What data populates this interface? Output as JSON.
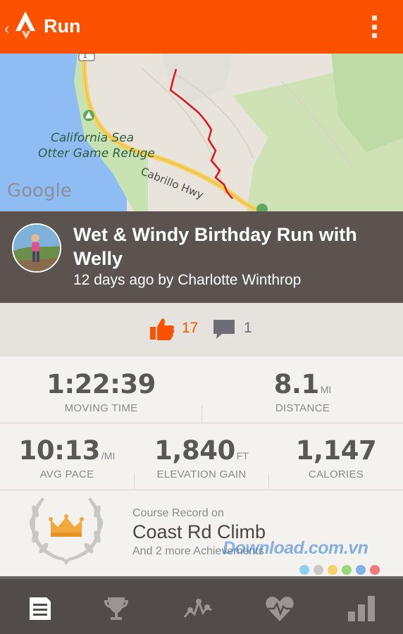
{
  "app_bar": {
    "title": "Run",
    "icons": [
      "strava-logo-icon",
      "overflow-menu-icon"
    ]
  },
  "map": {
    "labels": [
      "California Sea",
      "Otter Game Refuge"
    ],
    "road": "Cabrillo Hwy",
    "route_marker": "1",
    "attribution": "Google"
  },
  "activity": {
    "title": "Wet & Windy Birthday Run with Welly",
    "subtitle": "12 days ago by Charlotte Winthrop"
  },
  "social": {
    "kudos_count": "17",
    "comment_count": "1",
    "kudos_color": "#fc5200"
  },
  "stats": {
    "moving_time": {
      "value": "1:22:39",
      "unit": "",
      "label": "MOVING TIME"
    },
    "distance": {
      "value": "8.1",
      "unit": "MI",
      "label": "DISTANCE"
    },
    "avg_pace": {
      "value": "10:13",
      "unit": "/MI",
      "label": "AVG PACE"
    },
    "elevation_gain": {
      "value": "1,840",
      "unit": "FT",
      "label": "ELEVATION GAIN"
    },
    "calories": {
      "value": "1,147",
      "unit": "",
      "label": "CALORIES"
    }
  },
  "achievement": {
    "prefix": "Course Record on",
    "segment": "Coast Rd Climb",
    "more": "And 2 more Achievements"
  },
  "watermark": "Download.com.vn",
  "bottom_nav": [
    "feed-icon",
    "trophy-icon",
    "segments-icon",
    "heart-rate-icon",
    "stats-icon"
  ],
  "colors": {
    "accent": "#fc5200",
    "header_bg": "#5a5350",
    "nav_bg": "#514b49"
  }
}
